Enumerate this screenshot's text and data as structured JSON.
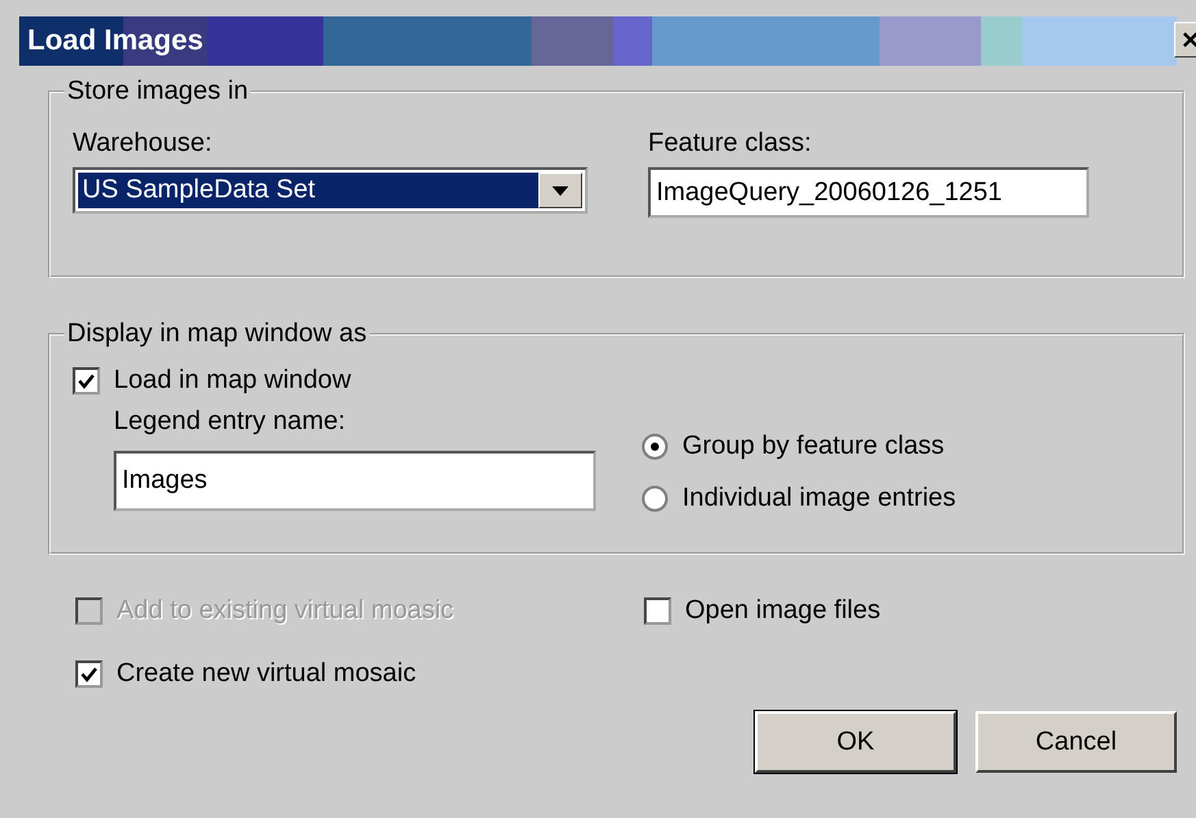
{
  "window": {
    "title": "Load Images"
  },
  "store_group": {
    "title": "Store images in",
    "warehouse": {
      "label": "Warehouse:",
      "value": "US SampleData Set",
      "highlighted": true
    },
    "feature_class": {
      "label": "Feature class:",
      "value": "ImageQuery_20060126_1251"
    }
  },
  "display_group": {
    "title": "Display in map window as",
    "load_in_map": {
      "label": "Load in map window",
      "checked": true
    },
    "legend_entry": {
      "label": "Legend entry name:",
      "value": "Images"
    },
    "grouping": [
      {
        "label": "Group by feature class",
        "selected": true
      },
      {
        "label": "Individual image entries",
        "selected": false
      }
    ]
  },
  "options": [
    {
      "label": "Add to existing virtual moasic",
      "checked": false,
      "disabled": true
    },
    {
      "label": "Open image files",
      "checked": false,
      "disabled": false
    },
    {
      "label": "Create new virtual mosaic",
      "checked": true,
      "disabled": false
    }
  ],
  "buttons": [
    "OK",
    "Cancel"
  ]
}
